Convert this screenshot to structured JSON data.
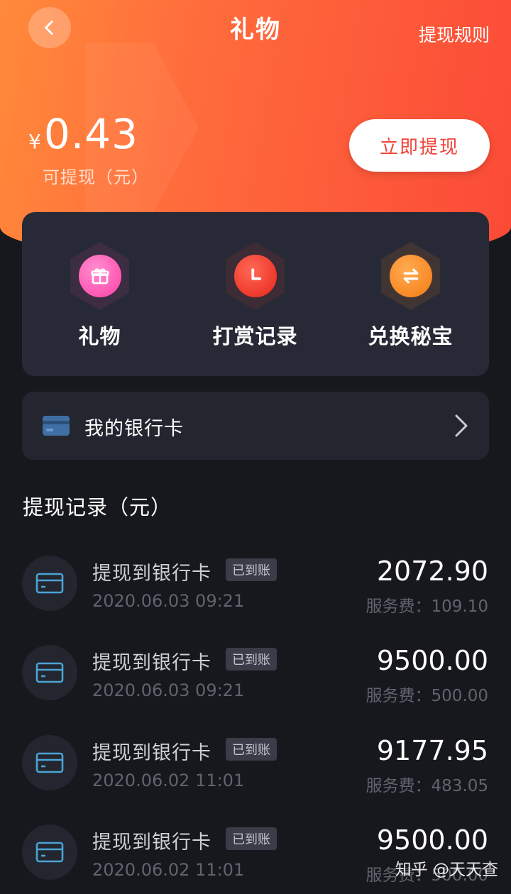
{
  "header": {
    "title": "礼物",
    "rules_link": "提现规则"
  },
  "balance": {
    "currency": "¥",
    "amount": "0.43",
    "label": "可提现（元）",
    "withdraw_button": "立即提现"
  },
  "quick_actions": [
    {
      "label": "礼物",
      "icon": "gift-icon",
      "color": "#ff4fb0"
    },
    {
      "label": "打赏记录",
      "icon": "clock-icon",
      "color": "#ff3b30"
    },
    {
      "label": "兑换秘宝",
      "icon": "exchange-icon",
      "color": "#ff8a1f"
    }
  ],
  "bank_card": {
    "label": "我的银行卡"
  },
  "records_section": {
    "title": "提现记录（元）",
    "items": [
      {
        "title": "提现到银行卡",
        "status": "已到账",
        "date": "2020.06.03 09:21",
        "amount": "2072.90",
        "fee": "服务费：109.10"
      },
      {
        "title": "提现到银行卡",
        "status": "已到账",
        "date": "2020.06.03 09:21",
        "amount": "9500.00",
        "fee": "服务费：500.00"
      },
      {
        "title": "提现到银行卡",
        "status": "已到账",
        "date": "2020.06.02 11:01",
        "amount": "9177.95",
        "fee": "服务费：483.05"
      },
      {
        "title": "提现到银行卡",
        "status": "已到账",
        "date": "2020.06.02 11:01",
        "amount": "9500.00",
        "fee": "服务费：500.00"
      }
    ]
  },
  "watermark": "知乎 @天天查",
  "colors": {
    "accent_orange": "#ff6d3c",
    "accent_red": "#fb4a37",
    "card_bg": "#272a36",
    "page_bg": "#17181d"
  }
}
